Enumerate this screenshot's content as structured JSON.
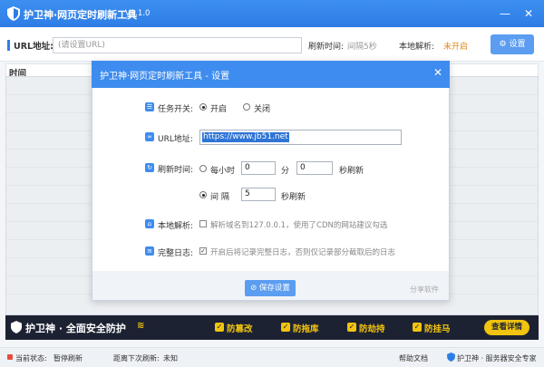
{
  "app": {
    "title": "护卫神·网页定时刷新工具",
    "version": "V1.1.0"
  },
  "url_row": {
    "label": "URL地址:",
    "placeholder": "(请设置URL)",
    "refresh_label": "刷新时间:",
    "refresh_value": "间隔5秒",
    "local_label": "本地解析:",
    "local_value": "未开启",
    "settings_button": "设置"
  },
  "table": {
    "col_time": "时间"
  },
  "dialog": {
    "title": "护卫神·网页定时刷新工具 - 设置",
    "task_label": "任务开关:",
    "task_on": "开启",
    "task_off": "关闭",
    "url_label": "URL地址:",
    "url_value": "https://www.jb51.net",
    "refresh_label": "刷新时间:",
    "hourly_prefix": "每小时",
    "hourly_min_value": "0",
    "min_unit": "分",
    "hourly_sec_value": "0",
    "hourly_suffix": "秒刷新",
    "interval_label": "间 隔",
    "interval_value": "5",
    "interval_suffix": "秒刷新",
    "local_label": "本地解析:",
    "local_text": "解析域名到127.0.0.1，使用了CDN的网站建议勾选",
    "log_label": "完整日志:",
    "log_text": "开启后将记录完整日志，否则仅记录部分截取后的日志",
    "save_button": "保存设置",
    "share_link": "分享软件"
  },
  "banner": {
    "title": "护卫神 · 全面安全防护",
    "features": [
      "防篡改",
      "防拖库",
      "防劫持",
      "防挂马"
    ],
    "detail_button": "查看详情"
  },
  "status": {
    "current_label": "当前状态:",
    "current_value": "暂停刷新",
    "next_label": "距离下次刷新:",
    "next_value": "未知",
    "help": "帮助文档",
    "brand": "护卫神 · 服务器安全专家"
  },
  "colors": {
    "primary": "#3e8cef",
    "banner_bg": "#1d2233",
    "banner_accent": "#f1c40f",
    "status_warn": "#e08a1a"
  }
}
